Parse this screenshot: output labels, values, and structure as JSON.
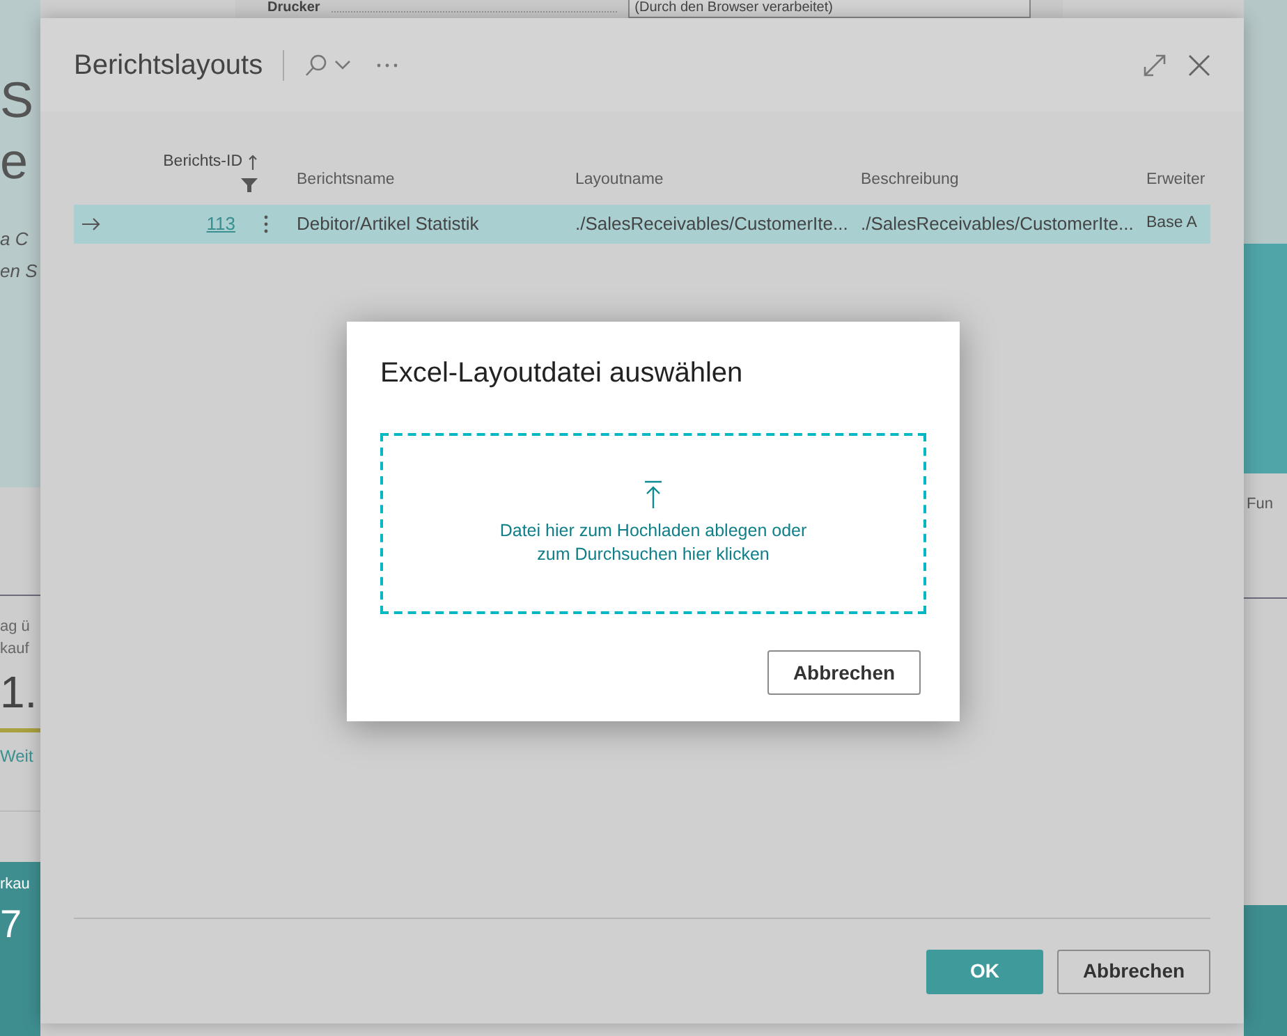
{
  "background_page": {
    "printer_label": "Drucker",
    "printer_value": "(Durch den Browser verarbeitet)",
    "left_strip": {
      "hero_lines": [
        "S",
        "e"
      ],
      "subtitle_lines": [
        "a C",
        "en S"
      ],
      "kpi_caption_lines": [
        "ag ü",
        "kauf"
      ],
      "kpi_value": "1.",
      "kpi_link": "Weit",
      "tile_caption": "rkau",
      "tile_value": "7"
    },
    "right_strip": {
      "caption": "Fun"
    }
  },
  "dialog": {
    "title": "Berichtslayouts",
    "columns": [
      {
        "label": "Berichts-ID",
        "sorted": true,
        "filtered": true
      },
      {
        "label": "Berichtsname",
        "sorted": false,
        "filtered": false
      },
      {
        "label": "Layoutname",
        "sorted": false,
        "filtered": false
      },
      {
        "label": "Beschreibung",
        "sorted": false,
        "filtered": false
      },
      {
        "label": "Erweiter",
        "sorted": false,
        "filtered": false
      }
    ],
    "rows": [
      {
        "selected": true,
        "cells": [
          "113",
          "Debitor/Artikel Statistik",
          "./SalesReceivables/CustomerIte...",
          "./SalesReceivables/CustomerIte...",
          "Base A"
        ]
      }
    ],
    "buttons": [
      {
        "label": "OK",
        "kind": "primary"
      },
      {
        "label": "Abbrechen",
        "kind": "secondary"
      }
    ]
  },
  "upload_dialog": {
    "title": "Excel-Layoutdatei auswählen",
    "drop_text": "Datei hier zum Hochladen ablegen oder zum Durchsuchen hier klicken",
    "buttons": [
      {
        "label": "Abbrechen",
        "kind": "secondary"
      }
    ]
  }
}
